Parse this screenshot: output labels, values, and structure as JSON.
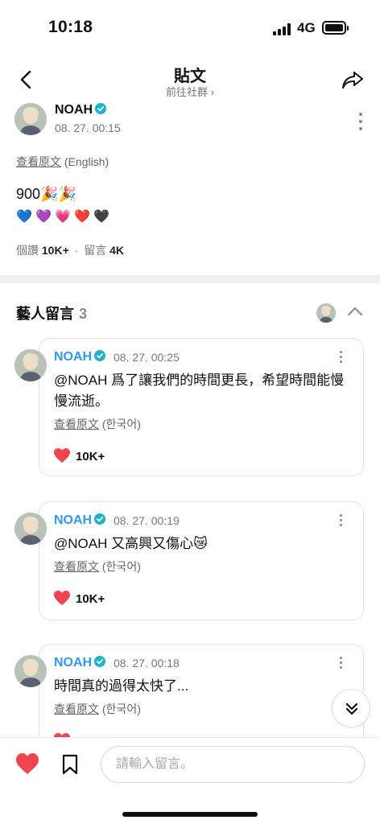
{
  "status_bar": {
    "time": "10:18",
    "network": "4G"
  },
  "header": {
    "title": "貼文",
    "subtitle": "前往社群 ›"
  },
  "post": {
    "author": "NOAH",
    "timestamp": "08. 27. 00:15",
    "translate_link": "查看原文",
    "translate_lang": "(English)",
    "body_line1": "900🎉🎉",
    "emoji_line": [
      "💙",
      "💜",
      "💗",
      "❤️",
      "🖤"
    ],
    "stats": {
      "views_label": "個讚",
      "views_value": "10K+",
      "separator": "·",
      "comments_label": "留言",
      "comments_value": "4K"
    }
  },
  "artist_comments": {
    "title": "藝人留言",
    "count": "3",
    "items": [
      {
        "author": "NOAH",
        "timestamp": "08. 27. 00:25",
        "text": "@NOAH 爲了讓我們的時間更長，希望時間能慢慢流逝。",
        "translate_link": "查看原文",
        "translate_lang": "(한국어)",
        "likes": "10K+"
      },
      {
        "author": "NOAH",
        "timestamp": "08. 27. 00:19",
        "text": "@NOAH 又高興又傷心😿",
        "translate_link": "查看原文",
        "translate_lang": "(한국어)",
        "likes": "10K+"
      },
      {
        "author": "NOAH",
        "timestamp": "08. 27. 00:18",
        "text": "時間真的過得太快了...",
        "translate_link": "查看原文",
        "translate_lang": "(한국어)",
        "likes": ""
      }
    ]
  },
  "composer": {
    "placeholder": "請輸入留言。"
  },
  "colors": {
    "accent_blue": "#2e9bf0",
    "verified_teal": "#1bb5c7",
    "heart_red": "#f0454f"
  },
  "icons": [
    "back-icon",
    "share-icon",
    "more-vertical-icon",
    "verified-icon",
    "chevron-up-icon",
    "heart-icon",
    "bookmark-icon",
    "double-chevron-down-icon"
  ]
}
